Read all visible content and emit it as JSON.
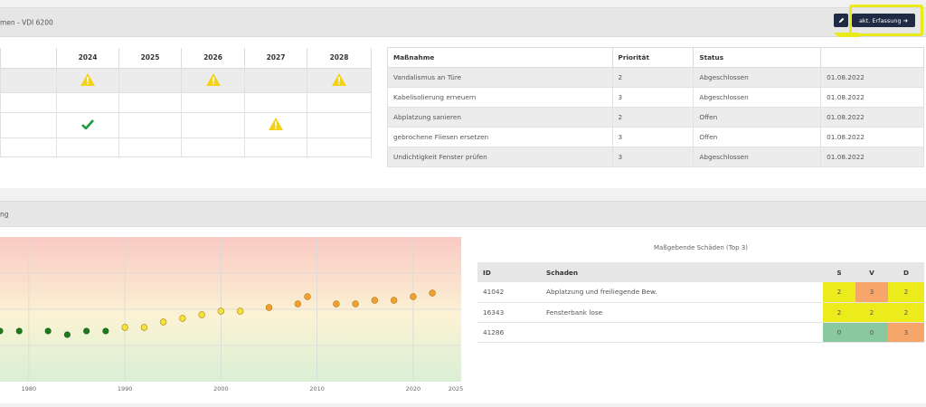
{
  "header1": {
    "title": "men - VDI 6200",
    "akt_label": "akt. Erfassung",
    "arrow_glyph": "➔",
    "edit_icon": "pencil-icon"
  },
  "year_table": {
    "years": [
      "2024",
      "2025",
      "2026",
      "2027",
      "2028"
    ],
    "rows": [
      [
        "warn",
        "",
        "warn",
        "",
        "warn"
      ],
      [
        "",
        "",
        "",
        "",
        ""
      ],
      [
        "check",
        "",
        "",
        "warn",
        ""
      ],
      [
        "",
        "",
        "",
        "",
        ""
      ]
    ]
  },
  "measures": {
    "headers": [
      "Maßnahme",
      "Priorität",
      "Status",
      ""
    ],
    "rows": [
      [
        "Vandalismus an Türe",
        "2",
        "Abgeschlossen",
        "01.08.2022"
      ],
      [
        "Kabelisolierung erneuern",
        "3",
        "Abgeschlossen",
        "01.08.2022"
      ],
      [
        "Abplatzung sanieren",
        "2",
        "Offen",
        "01.08.2022"
      ],
      [
        "gebrochene Fliesen ersetzen",
        "3",
        "Offen",
        "01.08.2022"
      ],
      [
        "Undichtigkeit Fenster prüfen",
        "3",
        "Abgeschlossen",
        "01.08.2022"
      ]
    ]
  },
  "header2": {
    "title": "ng"
  },
  "chart_data": {
    "type": "scatter",
    "xlim": [
      1977,
      2025
    ],
    "ylim": [
      0,
      8
    ],
    "x_ticks": [
      "1980",
      "1990",
      "2000",
      "2010",
      "2020",
      "2025"
    ],
    "grid": true,
    "colors": {
      "green": "#1f7a1f",
      "yellow": "#f2e23c",
      "orange": "#f0a030"
    },
    "points": [
      {
        "x": 1977,
        "y": 2.8,
        "c": "green"
      },
      {
        "x": 1979,
        "y": 2.8,
        "c": "green"
      },
      {
        "x": 1982,
        "y": 2.8,
        "c": "green"
      },
      {
        "x": 1984,
        "y": 2.6,
        "c": "green"
      },
      {
        "x": 1986,
        "y": 2.8,
        "c": "green"
      },
      {
        "x": 1988,
        "y": 2.8,
        "c": "green"
      },
      {
        "x": 1990,
        "y": 3.0,
        "c": "yellow"
      },
      {
        "x": 1992,
        "y": 3.0,
        "c": "yellow"
      },
      {
        "x": 1994,
        "y": 3.3,
        "c": "yellow"
      },
      {
        "x": 1996,
        "y": 3.5,
        "c": "yellow"
      },
      {
        "x": 1998,
        "y": 3.7,
        "c": "yellow"
      },
      {
        "x": 2000,
        "y": 3.9,
        "c": "yellow"
      },
      {
        "x": 2002,
        "y": 3.9,
        "c": "yellow"
      },
      {
        "x": 2005,
        "y": 4.1,
        "c": "orange"
      },
      {
        "x": 2008,
        "y": 4.3,
        "c": "orange"
      },
      {
        "x": 2009,
        "y": 4.7,
        "c": "orange"
      },
      {
        "x": 2012,
        "y": 4.3,
        "c": "orange"
      },
      {
        "x": 2014,
        "y": 4.3,
        "c": "orange"
      },
      {
        "x": 2016,
        "y": 4.5,
        "c": "orange"
      },
      {
        "x": 2018,
        "y": 4.5,
        "c": "orange"
      },
      {
        "x": 2020,
        "y": 4.7,
        "c": "orange"
      },
      {
        "x": 2022,
        "y": 4.9,
        "c": "orange"
      }
    ]
  },
  "damages": {
    "caption": "Maßgebende Schäden (Top 3)",
    "headers": [
      "ID",
      "Schaden",
      "S",
      "V",
      "D"
    ],
    "rows": [
      {
        "id": "41042",
        "name": "Abplatzung und freiliegende Bew.",
        "s": "2",
        "v": "3",
        "d": "2",
        "sc": "yel",
        "vc": "ora",
        "dc": "yel"
      },
      {
        "id": "16343",
        "name": "Fensterbank lose",
        "s": "2",
        "v": "2",
        "d": "2",
        "sc": "yel",
        "vc": "yel",
        "dc": "yel"
      },
      {
        "id": "41286",
        "name": "",
        "s": "0",
        "v": "0",
        "d": "3",
        "sc": "grn",
        "vc": "grn",
        "dc": "ora"
      }
    ]
  }
}
